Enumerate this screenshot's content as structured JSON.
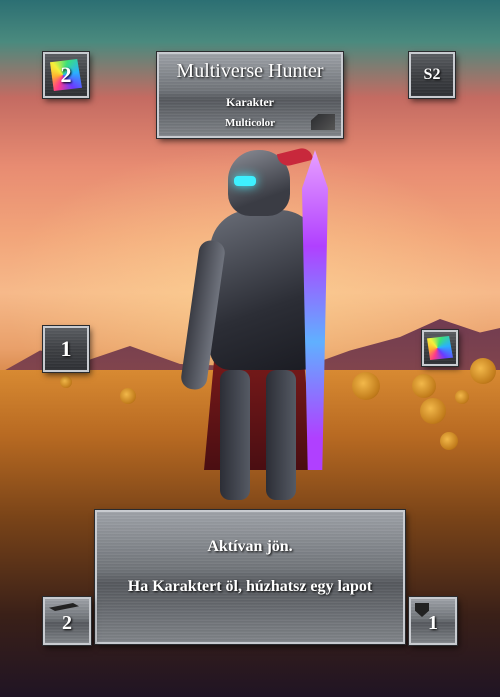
{
  "card": {
    "name": "Multiverse Hunter",
    "type": "Karakter",
    "color": "Multicolor",
    "cost": "2",
    "set": "S2",
    "power": "1",
    "attack": "2",
    "defense": "1",
    "text_line1": "Aktívan jön.",
    "text_line2": "Ha Karaktert öl, húzhatsz egy lapot"
  },
  "icons": {
    "cost": "rainbow-gem-icon",
    "element": "rainbow-gem-icon",
    "attack": "blade-icon",
    "defense": "shield-icon"
  }
}
